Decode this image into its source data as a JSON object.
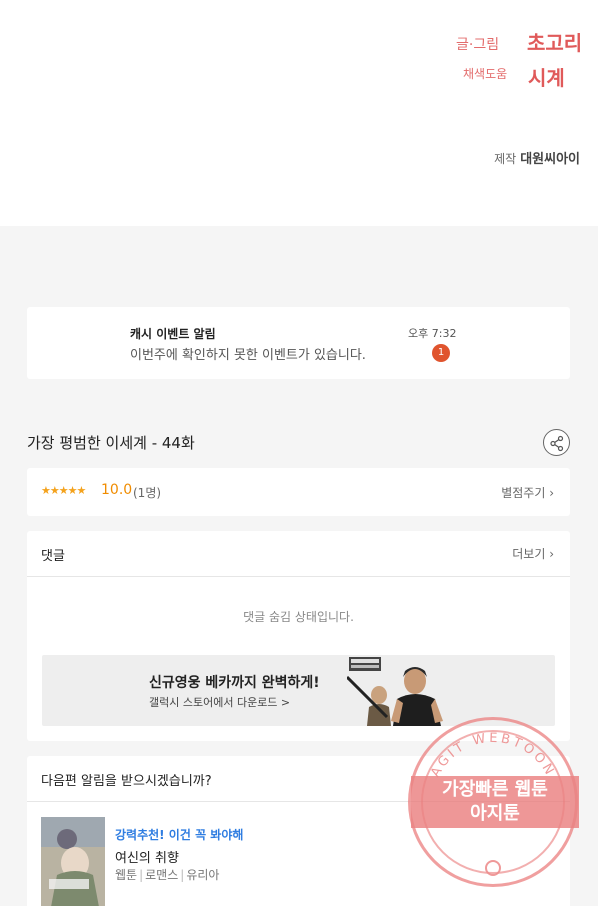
{
  "credits": {
    "writer_label": "글·그림",
    "writer_name": "초고리",
    "colorist_label": "채색도움",
    "colorist_name": "시계",
    "production_label": "제작",
    "production_name": "대원씨아이"
  },
  "notification": {
    "title": "캐시 이벤트 알림",
    "body": "이번주에 확인하지 못한 이벤트가 있습니다.",
    "time": "오후 7:32",
    "badge": "1"
  },
  "episode": {
    "title": "가장 평범한 이세계 - 44화"
  },
  "rating": {
    "stars": "★★★★★",
    "score": "10.0",
    "count": "(1명)",
    "rate_link": "별점주기 ›"
  },
  "comments": {
    "header": "댓글",
    "more": "더보기 ›",
    "hidden_msg": "댓글 숨김 상태입니다."
  },
  "banner": {
    "title": "신규영웅 베카까지 완벽하게!",
    "subtitle": "갤럭시 스토어에서 다운로드 >"
  },
  "next": {
    "header": "다음편 알림을 받으시겠습니까?",
    "rec_tag": "강력추천! 이건 꼭 봐야해",
    "rec_title": "여신의 취향",
    "rec_genre1": "웹툰",
    "rec_genre2": "로맨스",
    "rec_genre3": "유리아"
  },
  "watermark": {
    "arc_text": "AGIT WEBTOON",
    "line1": "가장빠른 웹툰",
    "line2": "아지툰"
  },
  "colors": {
    "accent_orange": "#f08c00",
    "badge_red": "#e0542e",
    "link_blue": "#2f7de1",
    "stamp_pink": "#e97878"
  }
}
